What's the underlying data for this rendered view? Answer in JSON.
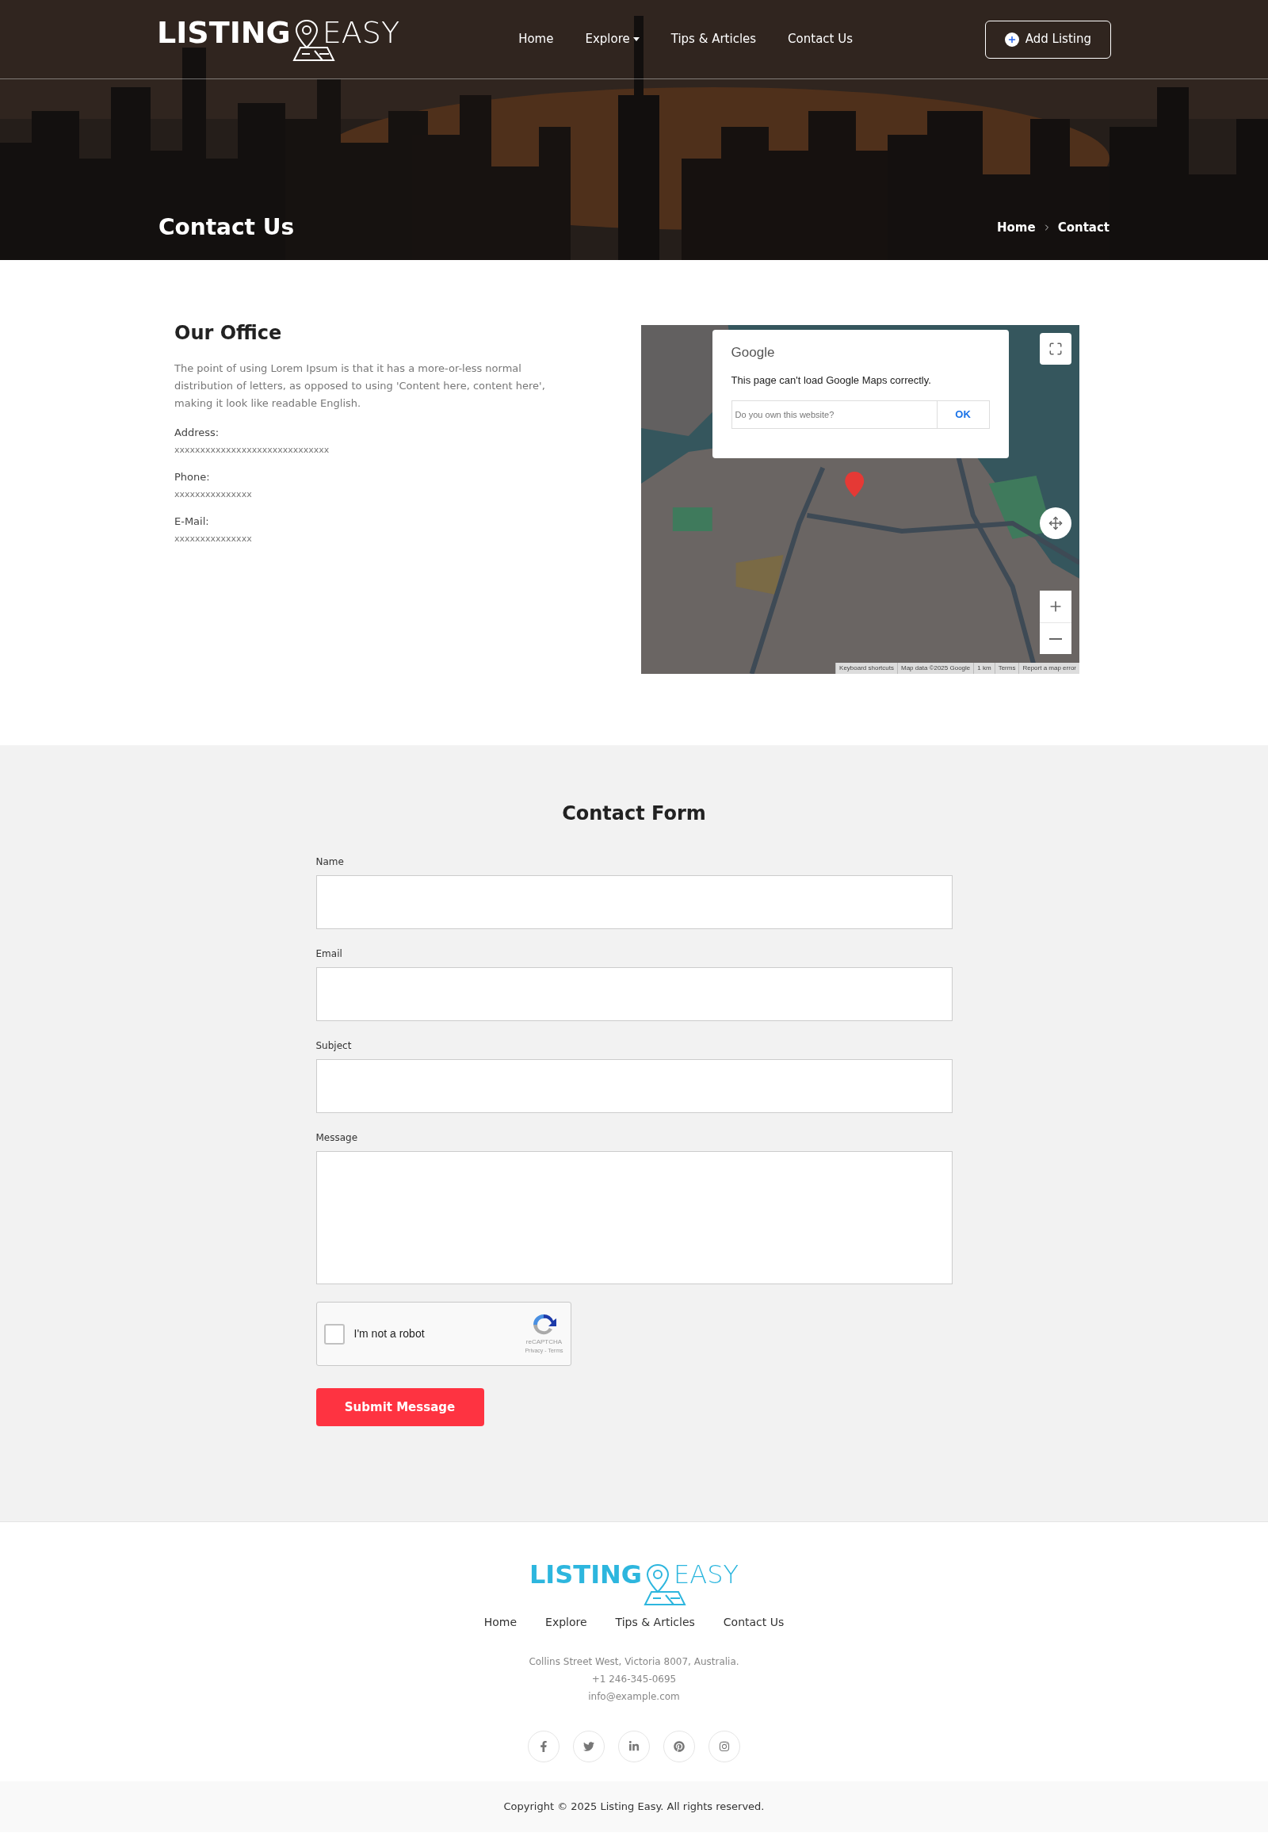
{
  "logo": {
    "bold": "LISTING",
    "light": "EASY"
  },
  "nav": [
    {
      "label": "Home",
      "dropdown": false
    },
    {
      "label": "Explore",
      "dropdown": true
    },
    {
      "label": "Tips & Articles",
      "dropdown": false
    },
    {
      "label": "Contact Us",
      "dropdown": false
    }
  ],
  "add_listing": "Add Listing",
  "page_title": "Contact Us",
  "breadcrumb": [
    "Home",
    "Contact"
  ],
  "office": {
    "title": "Our Office",
    "text": "The point of using Lorem Ipsum is that it has a more-or-less normal distribution of letters, as opposed to using 'Content here, content here', making it look like readable English.",
    "details": [
      {
        "label": "Address:",
        "value": "xxxxxxxxxxxxxxxxxxxxxxxxxxxxxx"
      },
      {
        "label": "Phone:",
        "value": "xxxxxxxxxxxxxxx"
      },
      {
        "label": "E-Mail:",
        "value": "xxxxxxxxxxxxxxx"
      }
    ]
  },
  "map": {
    "dialog": {
      "brand": "Google",
      "message": "This page can't load Google Maps correctly.",
      "question": "Do you own this website?",
      "button": "OK"
    },
    "attribution": [
      "Keyboard shortcuts",
      "Map data ©2025 Google",
      "1 km",
      "Terms",
      "Report a map error"
    ]
  },
  "form": {
    "title": "Contact Form",
    "fields": [
      {
        "label": "Name",
        "kind": "input"
      },
      {
        "label": "Email",
        "kind": "input"
      },
      {
        "label": "Subject",
        "kind": "input"
      },
      {
        "label": "Message",
        "kind": "textarea"
      }
    ],
    "captcha": {
      "label": "I'm not a robot",
      "checked": false,
      "brand": "reCAPTCHA",
      "links": "Privacy - Terms"
    },
    "submit": "Submit Message"
  },
  "footer": {
    "logo": {
      "bold": "LISTING",
      "light": "EASY"
    },
    "nav": [
      "Home",
      "Explore",
      "Tips & Articles",
      "Contact Us"
    ],
    "contact": [
      "Collins Street West, Victoria 8007, Australia.",
      "+1 246-345-0695",
      "info@example.com"
    ],
    "social": [
      {
        "kind": "facebook"
      },
      {
        "kind": "twitter"
      },
      {
        "kind": "linkedin"
      },
      {
        "kind": "pinterest"
      },
      {
        "kind": "instagram"
      }
    ],
    "copyright": "Copyright © 2025 Listing Easy. All rights reserved."
  }
}
